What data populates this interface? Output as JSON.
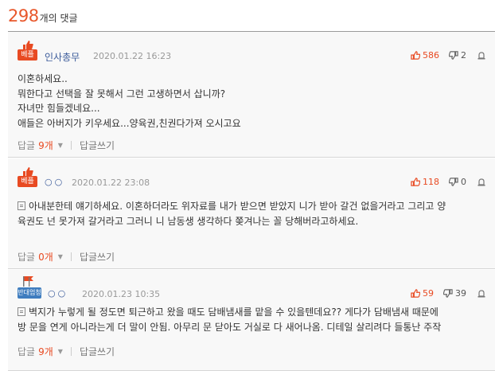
{
  "header": {
    "count": "298",
    "suffix": "개의 댓글"
  },
  "labels": {
    "reply_count_prefix": "답글",
    "reply_write": "답글쓰기",
    "best_badge": "베플",
    "opp_badge": "반대엄청"
  },
  "comments": [
    {
      "badge": "best",
      "author": "인사총무",
      "date": "2020.01.22 16:23",
      "up": "586",
      "down": "2",
      "body": [
        "이혼하세요..",
        "뭐한다고 선택을 잘 못해서 그런 고생하면서 삽니까?",
        "자녀만 힘들겠네요...",
        "애들은 아버지가 키우세요...양육권,친권다가져 오시고요"
      ],
      "replies": "9개"
    },
    {
      "badge": "best",
      "author": "○○",
      "date": "2020.01.22 23:08",
      "up": "118",
      "down": "0",
      "body": [
        "아내분한테 얘기하세요. 이혼하더라도 위자료를 내가 받으면 받았지 니가 받아 갈건 없을거라고 그리고 양",
        "육권도 넌 못가져 갈거라고 그러니 니 남동생 생각하다 쫒겨나는 꼴 당해버라고하세요."
      ],
      "replies": "0개"
    },
    {
      "badge": "opp",
      "author": "○○",
      "date": "2020.01.23 10:35",
      "up": "59",
      "down": "39",
      "body": [
        "벽지가 누렇게 될 정도면 퇴근하고 왔을 때도 담배냄새를 맡을 수 있을텐데요?? 게다가 담배냄새 때문에",
        "방 문을 연게 아니라는게 더 말이 안됨. 아무리 문 닫아도 거실로 다 새어나옴. 디테일 살리려다 들통난 주작"
      ],
      "replies": "9개"
    }
  ]
}
